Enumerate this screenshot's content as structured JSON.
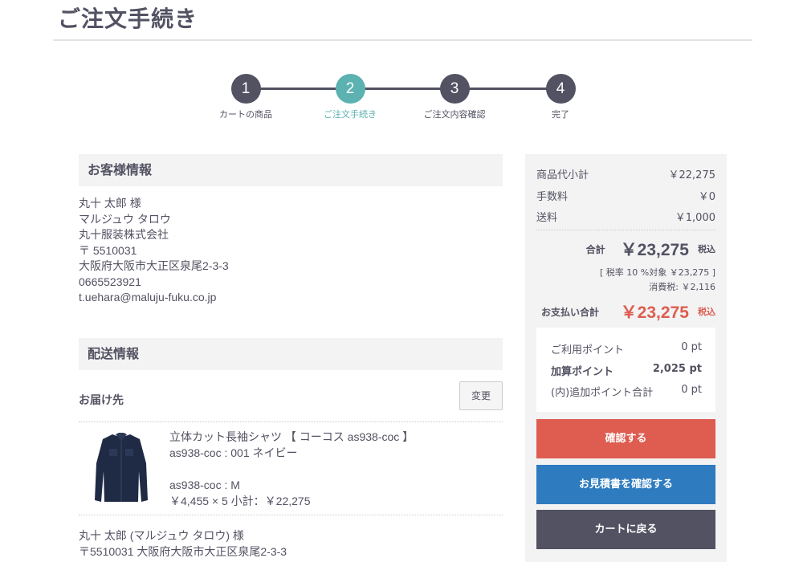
{
  "page": {
    "title": "ご注文手続き"
  },
  "steps": [
    {
      "num": "1",
      "label": "カートの商品"
    },
    {
      "num": "2",
      "label": "ご注文手続き"
    },
    {
      "num": "3",
      "label": "ご注文内容確認"
    },
    {
      "num": "4",
      "label": "完了"
    }
  ],
  "customer": {
    "heading": "お客様情報",
    "name": "丸十 太郎 様",
    "kana": "マルジュウ タロウ",
    "company": "丸十服装株式会社",
    "zip": "〒 5510031",
    "address": "大阪府大阪市大正区泉尾2-3-3",
    "phone": "0665523921",
    "email": "t.uehara@maluju-fuku.co.jp"
  },
  "shipping": {
    "heading": "配送情報",
    "deliver_label": "お届け先",
    "change_label": "変更",
    "product": {
      "name": "立体カット長袖シャツ 【 コーコス as938-coc 】",
      "color": "as938-coc : 001 ネイビー",
      "size": "as938-coc : M",
      "price": "￥4,455 × 5  小計：￥22,275"
    },
    "recipient_name": "丸十 太郎 (マルジュウ タロウ) 様",
    "recipient_address": "〒5510031 大阪府大阪市大正区泉尾2-3-3"
  },
  "summary": {
    "subtotal_label": "商品代小計",
    "subtotal_value": "￥22,275",
    "fee_label": "手数料",
    "fee_value": "￥0",
    "shipping_label": "送料",
    "shipping_value": "￥1,000",
    "total_label": "合計",
    "total_value": "￥23,275",
    "tax_incl": "税込",
    "tax_rate_line": "[ 税率 10 %対象 ￥23,275 ]",
    "tax_amount_line": "消費税: ￥2,116",
    "payment_label": "お支払い合計",
    "payment_value": "￥23,275",
    "payment_tax_incl": "税込"
  },
  "points": {
    "use_label": "ご利用ポイント",
    "use_value": "0 pt",
    "add_label": "加算ポイント",
    "add_value": "2,025 pt",
    "extra_label": "(内)追加ポイント合計",
    "extra_value": "0 pt"
  },
  "buttons": {
    "confirm": "確認する",
    "estimate": "お見積書を確認する",
    "back_to_cart": "カートに戻る"
  },
  "colors": {
    "text": "#525263",
    "active_step": "#5cb1b1",
    "confirm_button": "#de5d50",
    "estimate_button": "#2e7bbf",
    "cart_button": "#525263"
  }
}
